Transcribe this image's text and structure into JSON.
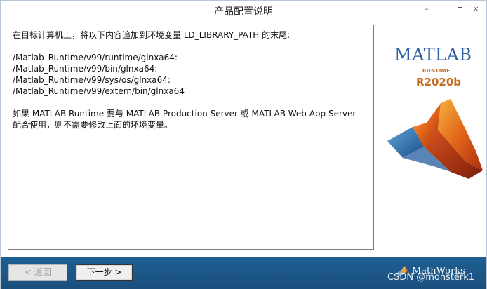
{
  "window": {
    "title": "产品配置说明",
    "minimize_icon": "–",
    "close_icon": "×"
  },
  "text_pane": {
    "lines": [
      "在目标计算机上，将以下内容追加到环境变量 LD_LIBRARY_PATH 的末尾:",
      "",
      "/Matlab_Runtime/v99/runtime/glnxa64:",
      "/Matlab_Runtime/v99/bin/glnxa64:",
      "/Matlab_Runtime/v99/sys/os/glnxa64:",
      "/Matlab_Runtime/v99/extern/bin/glnxa64",
      "",
      "如果 MATLAB Runtime 要与 MATLAB Production Server 或 MATLAB Web App Server",
      "配合使用，则不需要修改上面的环境变量。"
    ]
  },
  "logo": {
    "product": "MATLAB",
    "edition": "RUNTIME",
    "release": "R2020b"
  },
  "footer": {
    "back_label": "< 返回",
    "next_label": "下一步 >",
    "company": "MathWorks",
    "watermark": "CSDN @monsterk1"
  },
  "colors": {
    "footer_background": "#1d5a8c",
    "logo_blue": "#2d5fa3",
    "logo_orange": "#c46b1d"
  },
  "icons": {
    "membrane": "matlab-membrane-icon",
    "mathworks": "mathworks-logo-icon"
  }
}
